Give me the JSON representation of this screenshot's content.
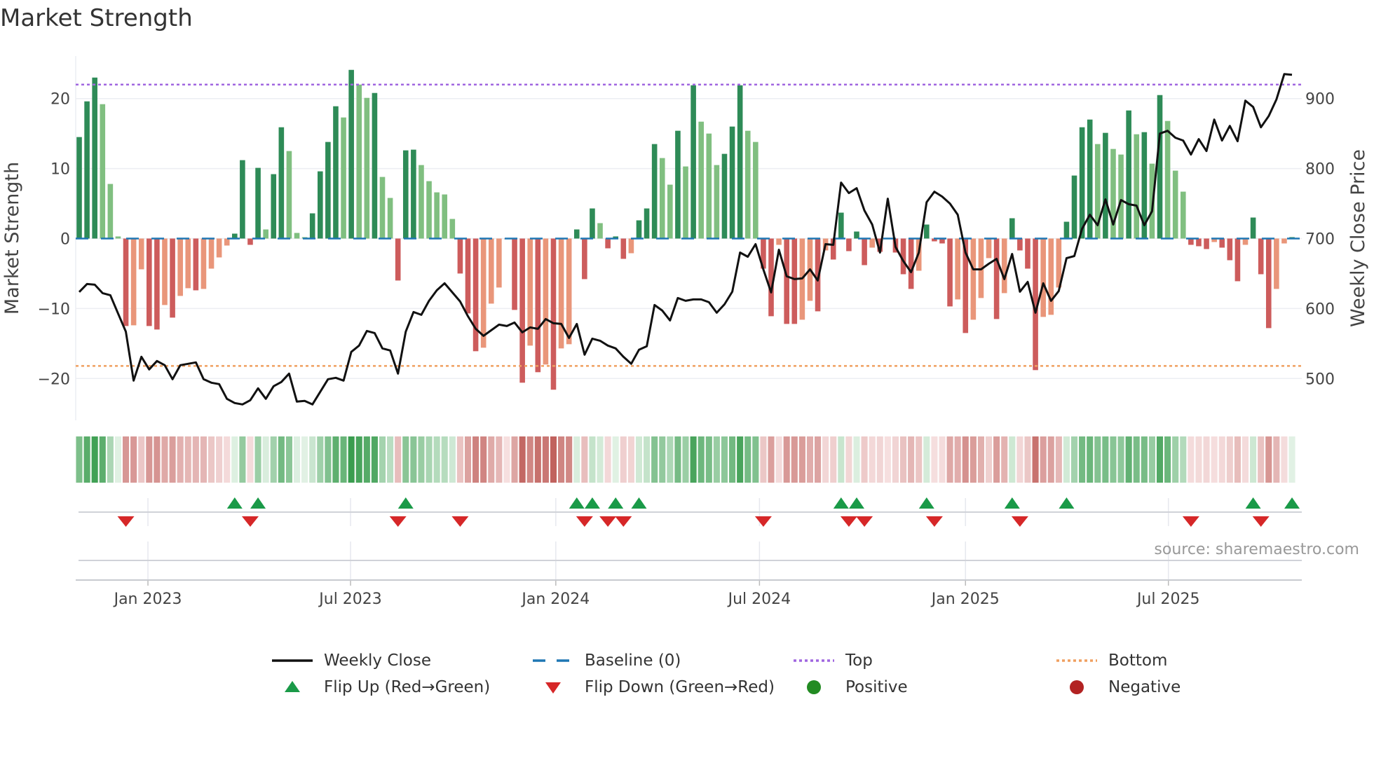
{
  "title": "Market Strength",
  "source": "source: sharemaestro.com",
  "colors": {
    "bar_up_strong": "#2e8b57",
    "bar_up_weak": "#80bf80",
    "bar_down_strong": "#cd5c5c",
    "bar_down_weak": "#e9967a",
    "line": "#111111",
    "baseline": "#1f77b4",
    "top": "#a066e0",
    "bottom": "#f0a060",
    "flip_up": "#1a9a48",
    "flip_down": "#d62728",
    "positive": "#228b22",
    "negative": "#b22222"
  },
  "chart_data": {
    "type": "bar+line",
    "title": "Market Strength",
    "ylabel": "Market Strength",
    "y2label": "Weekly Close Price",
    "ylim": [
      -26,
      27.5
    ],
    "y2lim": [
      440,
      975
    ],
    "yticks": [
      20,
      10,
      0,
      -10,
      -20
    ],
    "ytick_labels": [
      "20",
      "10",
      "0",
      "−10",
      "−20"
    ],
    "y2ticks": [
      900,
      800,
      700,
      600,
      500
    ],
    "y2tick_labels": [
      "900",
      "800",
      "700",
      "600",
      "500"
    ],
    "xticks": [
      {
        "label": "Jan 2023",
        "week": 8.84
      },
      {
        "label": "Jul 2023",
        "week": 34.9
      },
      {
        "label": "Jan 2024",
        "week": 61.3
      },
      {
        "label": "Jul 2024",
        "week": 87.5
      },
      {
        "label": "Jan 2025",
        "week": 114.0
      },
      {
        "label": "Jul 2025",
        "week": 140.1
      }
    ],
    "top_level": 22.0,
    "bottom_level": -18.2,
    "baseline": 0,
    "strength": [
      14.5,
      19.6,
      23.0,
      19.2,
      7.8,
      0.3,
      -12.5,
      -12.4,
      -4.4,
      -12.5,
      -13.0,
      -9.5,
      -11.3,
      -8.2,
      -7.1,
      -7.4,
      -7.2,
      -4.3,
      -2.7,
      -1.0,
      0.7,
      11.2,
      -0.9,
      10.1,
      1.3,
      9.2,
      15.9,
      12.5,
      0.8,
      0.2,
      3.6,
      9.6,
      13.8,
      18.9,
      17.3,
      24.1,
      22.0,
      20.1,
      20.8,
      8.8,
      5.8,
      -6.0,
      12.6,
      12.7,
      10.5,
      8.2,
      6.6,
      6.3,
      2.8,
      -5.0,
      -10.7,
      -16.1,
      -15.6,
      -9.3,
      -7.0,
      -0.1,
      -10.2,
      -20.6,
      -15.3,
      -19.1,
      -18.0,
      -21.6,
      -15.7,
      -15.1,
      1.3,
      -5.8,
      4.3,
      2.2,
      -1.4,
      0.3,
      -2.9,
      -2.1,
      2.6,
      4.3,
      13.5,
      11.5,
      7.7,
      15.4,
      10.3,
      21.9,
      16.7,
      15.0,
      10.5,
      12.1,
      16.0,
      21.9,
      15.4,
      13.8,
      -4.3,
      -11.1,
      -0.9,
      -12.2,
      -12.2,
      -11.6,
      -8.9,
      -10.4,
      -1.7,
      -3.0,
      3.7,
      -1.8,
      1.0,
      -3.8,
      -1.3,
      -1.9,
      -0.1,
      -2.0,
      -5.1,
      -7.2,
      -4.6,
      2.0,
      -0.4,
      -0.7,
      -9.7,
      -8.7,
      -13.5,
      -11.6,
      -8.5,
      -2.8,
      -11.5,
      -7.8,
      2.9,
      -1.7,
      -4.3,
      -18.8,
      -11.2,
      -10.9,
      -7.0,
      2.4,
      9.0,
      15.9,
      17.0,
      13.5,
      15.1,
      12.8,
      12.0,
      18.3,
      14.9,
      15.2,
      10.7,
      20.5,
      16.8,
      9.7,
      6.7,
      -0.9,
      -1.1,
      -1.5,
      -0.5,
      -1.3,
      -3.1,
      -6.1,
      -0.9,
      3.0,
      -5.1,
      -12.8,
      -7.2,
      -0.7,
      0.2
    ],
    "weekly_close": [
      623.6,
      635,
      634,
      622,
      619,
      593,
      567,
      497,
      531,
      513,
      525,
      519,
      499,
      519,
      521,
      523,
      499,
      494,
      492,
      471,
      465,
      463,
      469,
      486,
      471,
      489,
      495,
      507,
      467,
      468,
      463,
      481,
      499,
      501,
      497,
      538,
      547,
      568,
      565,
      543,
      540,
      507,
      567,
      595,
      591,
      611,
      626,
      636,
      623,
      610,
      589,
      571,
      561,
      569,
      577,
      575,
      580,
      566,
      573,
      571,
      585,
      579,
      578,
      558,
      578,
      534,
      557,
      554,
      547,
      543,
      531,
      521,
      541,
      546,
      605,
      597,
      583,
      615,
      611,
      613,
      613,
      609,
      594,
      606,
      624,
      680,
      674,
      692,
      656,
      623,
      684,
      646,
      642,
      643,
      656,
      640,
      692,
      691,
      780,
      765,
      772,
      740,
      720,
      680,
      757,
      688,
      668,
      652,
      680,
      752,
      767,
      760,
      750,
      734,
      680,
      656,
      656,
      664,
      671,
      642,
      678,
      624,
      638,
      594,
      636,
      611,
      625,
      672,
      675,
      714,
      734,
      719,
      756,
      720,
      755,
      749,
      747,
      719,
      739,
      850,
      854,
      844,
      840,
      820,
      842,
      825,
      870,
      840,
      861,
      839,
      897,
      888,
      859,
      875,
      899,
      935,
      934
    ],
    "legend": [
      {
        "label": "Weekly Close",
        "symbol": "line"
      },
      {
        "label": "Baseline (0)",
        "symbol": "dash"
      },
      {
        "label": "Top",
        "symbol": "dot-purple"
      },
      {
        "label": "Bottom",
        "symbol": "dot-orange"
      },
      {
        "label": "Flip Up (Red→Green)",
        "symbol": "triangle-up"
      },
      {
        "label": "Flip Down (Green→Red)",
        "symbol": "triangle-down"
      },
      {
        "label": "Positive",
        "symbol": "circle-green"
      },
      {
        "label": "Negative",
        "symbol": "circle-red"
      }
    ],
    "legend_position": "bottom-center"
  }
}
